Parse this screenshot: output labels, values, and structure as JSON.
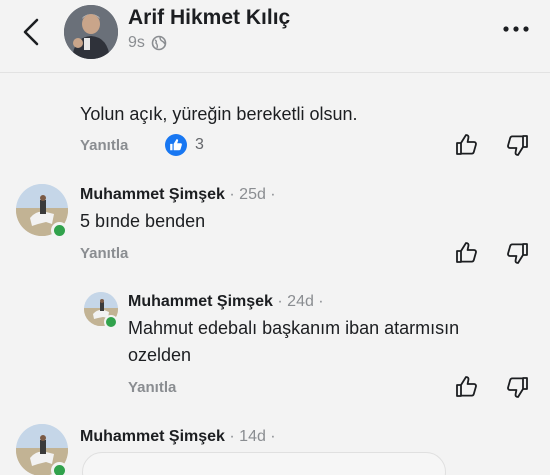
{
  "header": {
    "author_name": "Arif Hikmet Kılıç",
    "time": "9s"
  },
  "comments": [
    {
      "text": "Yolun açık, yüreğin bereketli olsun.",
      "reply_label": "Yanıtla",
      "like_count": "3"
    },
    {
      "name": "Muhammet Şimşek",
      "time": "· 25d ·",
      "text": "5 bınde benden",
      "reply_label": "Yanıtla"
    },
    {
      "name": "Muhammet Şimşek",
      "time": "· 24d ·",
      "text_line1": "Mahmut edebalı başkanım iban atarmısın",
      "text_line2": "ozelden",
      "reply_label": "Yanıtla"
    },
    {
      "name": "Muhammet Şimşek",
      "time": "· 14d ·"
    }
  ],
  "icons": {
    "back": "chevron-left-icon",
    "globe": "globe-icon",
    "more": "more-horizontal-icon",
    "like": "thumbs-up-icon",
    "dislike": "thumbs-down-icon"
  },
  "colors": {
    "background": "#f3f3f3",
    "like_blue": "#1877f2",
    "online_green": "#31a24c",
    "muted_text": "#8a8d91"
  }
}
